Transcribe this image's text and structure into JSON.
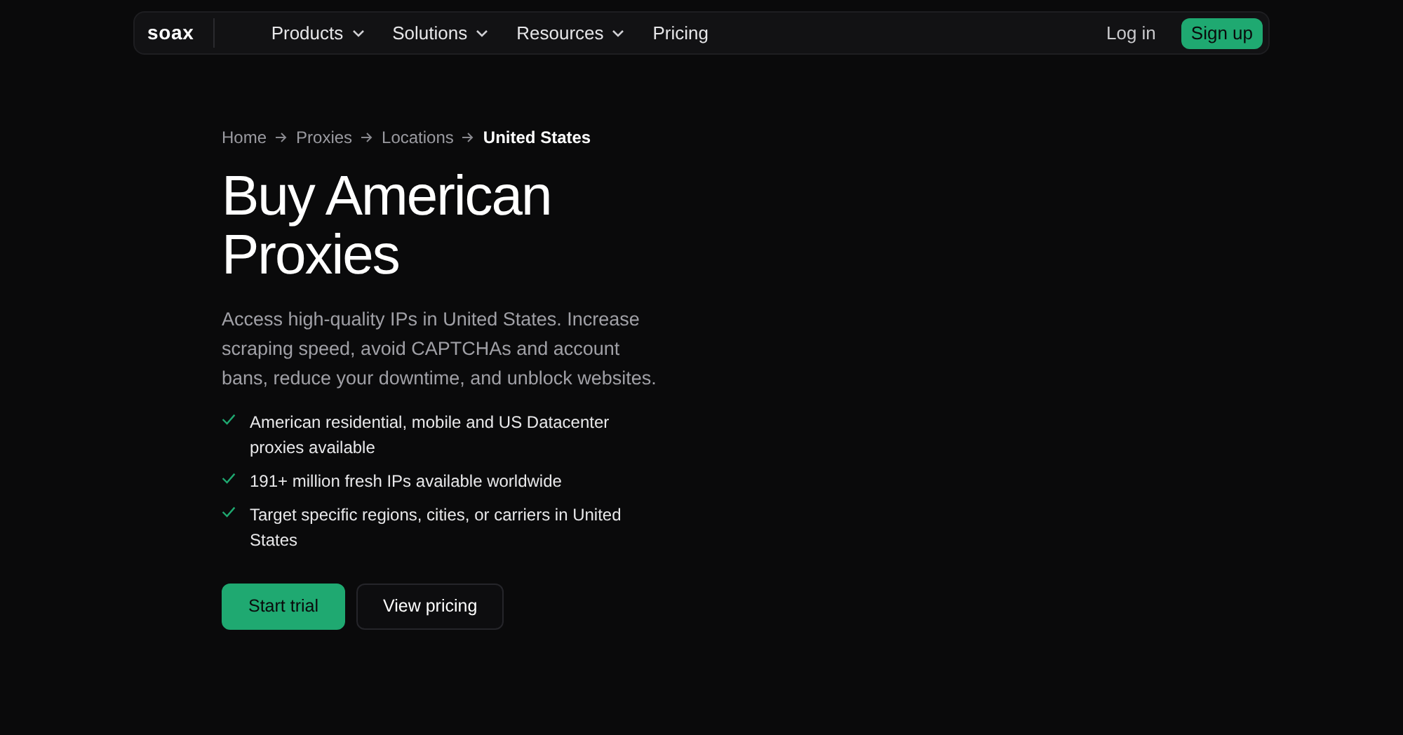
{
  "nav": {
    "logo": "soax",
    "items": [
      {
        "label": "Products",
        "kind": "dropdown"
      },
      {
        "label": "Solutions",
        "kind": "dropdown"
      },
      {
        "label": "Resources",
        "kind": "dropdown"
      },
      {
        "label": "Pricing",
        "kind": "link"
      }
    ],
    "login": "Log in",
    "signup": "Sign up"
  },
  "breadcrumb": [
    {
      "label": "Home",
      "current": false
    },
    {
      "label": "Proxies",
      "current": false
    },
    {
      "label": "Locations",
      "current": false
    },
    {
      "label": "United States",
      "current": true
    }
  ],
  "heading": "Buy American Proxies",
  "description": "Access high-quality IPs in United States. Increase scraping speed, avoid CAPTCHAs and account bans, reduce your downtime, and unblock websites.",
  "features": [
    "American residential, mobile and US Datacenter proxies available",
    "191+ million fresh IPs available worldwide",
    "Target specific regions, cities, or carriers in United States"
  ],
  "buttons": [
    {
      "label": "Start trial",
      "kind": "primary"
    },
    {
      "label": "View pricing",
      "kind": "secondary"
    }
  ]
}
